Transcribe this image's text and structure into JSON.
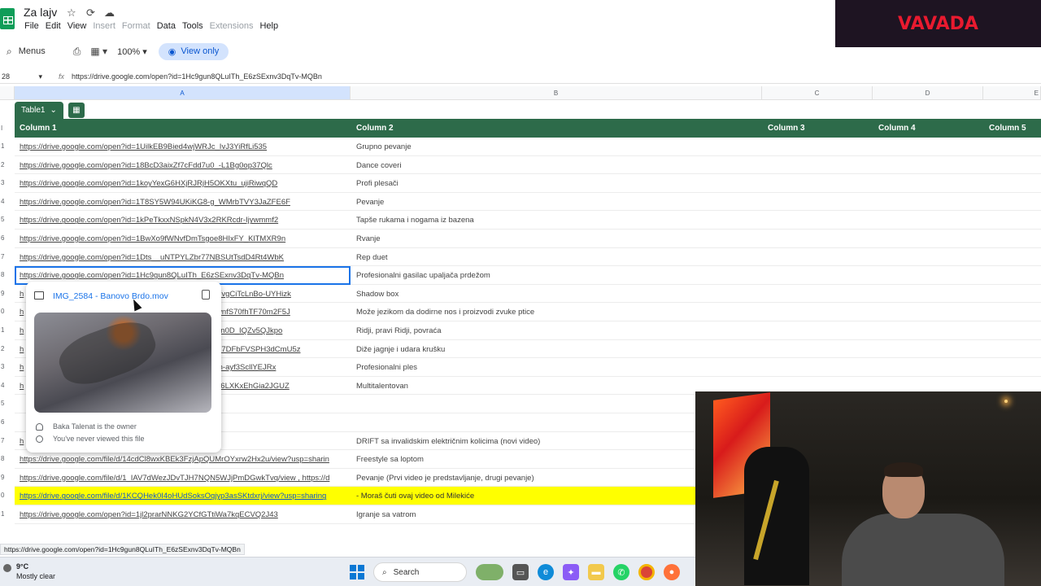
{
  "doc": {
    "title": "Za lajv",
    "icons": [
      "star-icon",
      "cloud-sync-icon",
      "cloud-icon"
    ]
  },
  "menu": [
    "File",
    "Edit",
    "View",
    "Insert",
    "Format",
    "Data",
    "Tools",
    "Extensions",
    "Help"
  ],
  "toolbar": {
    "menus_label": "Menus",
    "zoom": "100%",
    "view_only": "View only"
  },
  "formula_bar": {
    "cell_ref": "28",
    "value": "https://drive.google.com/open?id=1Hc9gun8QLuITh_E6zSExnv3DqTv-MQBn"
  },
  "columns": [
    "A",
    "B",
    "C",
    "D",
    "E"
  ],
  "table": {
    "name": "Table1",
    "headers": [
      "Column 1",
      "Column 2",
      "Column 3",
      "Column 4",
      "Column 5"
    ],
    "rows": [
      {
        "num": "1",
        "a": "https://drive.google.com/open?id=1UilkEB9Bied4wjWRJc_IvJ3YiRfLi535",
        "b": "Grupno pevanje"
      },
      {
        "num": "2",
        "a": "https://drive.google.com/open?id=18BcD3aixZf7cFdd7u0_-L1Bg0op37Qlc",
        "b": "Dance coveri"
      },
      {
        "num": "3",
        "a": "https://drive.google.com/open?id=1koyYexG6HXjRJRjH5OKXtu_ujiRiwqQD",
        "b": "Profi plesači"
      },
      {
        "num": "4",
        "a": "https://drive.google.com/open?id=1T8SY5W94UKiKG8-g_WMrbTVY3JaZFE6F",
        "b": "Pevanje"
      },
      {
        "num": "5",
        "a": "https://drive.google.com/open?id=1kPeTkxxNSpkN4V3x2RKRcdr-Ijywmmf2",
        "b": "Tapše rukama i nogama iz bazena"
      },
      {
        "num": "6",
        "a": "https://drive.google.com/open?id=1BwXo9fWNvfDmTsgoe8HIxFY_KlTMXR9n",
        "b": "Rvanje"
      },
      {
        "num": "7",
        "a": "https://drive.google.com/open?id=1Dts__uNTPYLZbr77NBSUtTsdD4Rt4WbK",
        "b": "Rep duet"
      },
      {
        "num": "8",
        "a": "https://drive.google.com/open?id=1Hc9gun8QLuITh_E6zSExnv3DqTv-MQBn",
        "b": "Profesionalni gasilac upaljača prdežom"
      },
      {
        "num": "9",
        "a": "h",
        "a_tail": "VvgCiTcLnBo-UYHizk",
        "b": "Shadow box"
      },
      {
        "num": "0",
        "a": "h",
        "a_tail": "wnfS70fhTF70m2F5J",
        "b": "Može jezikom da dodirne nos i proizvodi zvuke ptice"
      },
      {
        "num": "1",
        "a": "h",
        "a_tail": "8n0D_IQZv5QJkpo",
        "b": "Ridji, pravi Ridji, povraća"
      },
      {
        "num": "2",
        "a": "h",
        "a_tail": "A7DFbFVSPH3dCmU5z",
        "b": "Diže jagnje i udara krušku"
      },
      {
        "num": "3",
        "a": "h",
        "a_tail": "fh-ayf3ScllYEJRx",
        "b": "Profesionalni ples"
      },
      {
        "num": "4",
        "a": "h",
        "a_tail": "a6LXKxEhGia2JGUZ",
        "b": "Multitalentovan"
      },
      {
        "num": "5",
        "a": "",
        "b": ""
      },
      {
        "num": "6",
        "a": "",
        "b": ""
      },
      {
        "num": "7",
        "a": "h",
        "b": "DRIFT sa invalidskim električnim kolicima (novi video)"
      },
      {
        "num": "8",
        "a": "https://drive.google.com/file/d/14cdCl8wxKBEk3FzjApQUMrOYxrw2Hx2u/view?usp=sharin",
        "b": "Freestyle sa loptom"
      },
      {
        "num": "9",
        "a": "https://drive.google.com/file/d/1_IAV7dWezJDvTJH7NQN5WJjPmDGwkTvq/view , https://d",
        "b": "Pevanje (Prvi video je predstavljanje, drugi pevanje)"
      },
      {
        "num": "0",
        "a": "https://drive.google.com/file/d/1KCQHek0I4oHUdSoksOgjyp3asSKtdxrj/view?usp=sharing",
        "b": "- Moraš čuti ovaj video od Milekiće"
      },
      {
        "num": "1",
        "a": "https://drive.google.com/open?id=1jl2prarNNKG2YCfGTtiWa7kqECVQ2J43",
        "b": "Igranje sa vatrom"
      }
    ]
  },
  "hover_card": {
    "file_name": "IMG_2584 - Banovo Brdo.mov",
    "owner": "Baka Talenat is the owner",
    "viewed": "You've never viewed this file"
  },
  "status_url": "https://drive.google.com/open?id=1Hc9gun8QLuITh_E6zSExnv3DqTv-MQBn",
  "ad": {
    "brand": "VAVADA",
    "color": "#e91a2f"
  },
  "taskbar": {
    "temp": "9°C",
    "weather": "Mostly clear",
    "search": "Search"
  },
  "colors": {
    "table_header": "#2d6b4a",
    "highlight_row": "#ffff00",
    "selection": "#1a73e8",
    "view_only_bg": "#d3e3fd"
  }
}
